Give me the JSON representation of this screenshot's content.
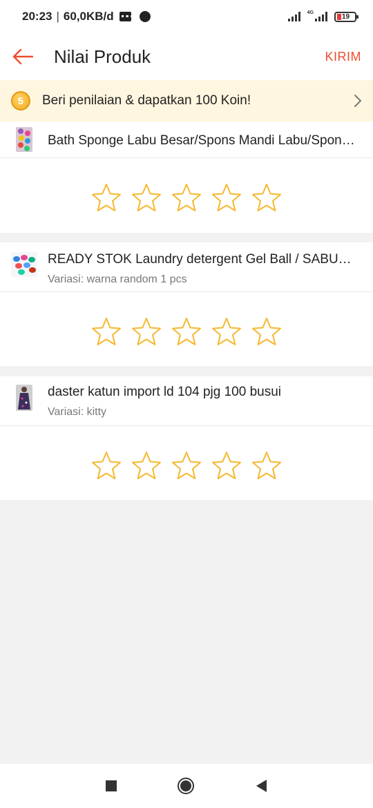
{
  "status_bar": {
    "time": "20:23",
    "network_speed": "60,0KB/d",
    "network_type": "4G",
    "battery_level": "19"
  },
  "header": {
    "title": "Nilai Produk",
    "submit_label": "KIRIM"
  },
  "coin_banner": {
    "coin_value": "5",
    "text": "Beri penilaian & dapatkan 100 Koin!"
  },
  "products": [
    {
      "name": "Bath Sponge Labu Besar/Spons Mandi Labu/Spon…",
      "variation": "",
      "rating": 0,
      "max_rating": 5
    },
    {
      "name": "READY STOK  Laundry detergent Gel Ball / SABUN …",
      "variation": "Variasi: warna random 1 pcs",
      "rating": 0,
      "max_rating": 5
    },
    {
      "name": "daster katun import ld 104   pjg 100 busui",
      "variation": "Variasi: kitty",
      "rating": 0,
      "max_rating": 5
    }
  ],
  "colors": {
    "accent": "#ee4d2d",
    "star_outline": "#f5b82e",
    "banner_bg": "#fff6e0"
  }
}
